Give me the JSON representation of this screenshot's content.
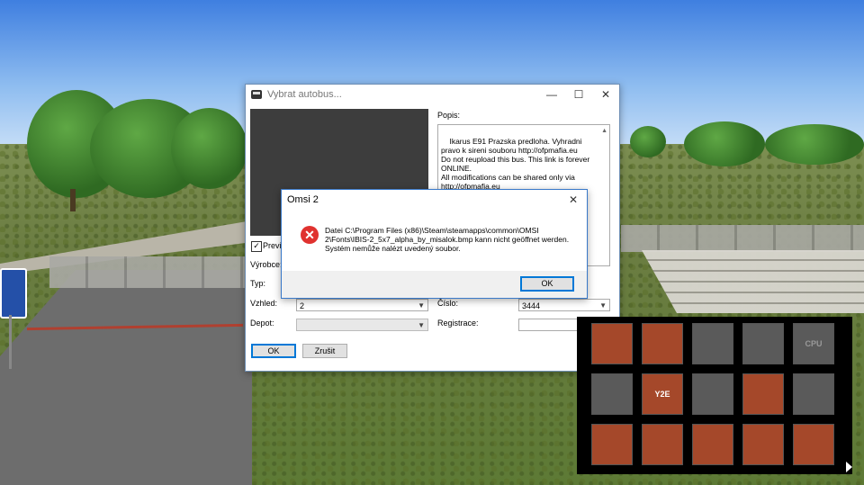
{
  "main_dialog": {
    "title": "Vybrat autobus...",
    "minimize": "—",
    "maximize": "☐",
    "close": "✕",
    "preview_label": "Preview",
    "preview_checked": "✓",
    "description_label": "Popis:",
    "description": "Ikarus E91 Prazska predloha. Vyhradni pravo k sireni souboru http://ofpmafia.eu\nDo not reupload this bus. This link is forever ONLINE.\nAll modifications can be shared only via http://ofpmafia.eu",
    "manufacturer_label": "Výrobce:",
    "type_label": "Typ:",
    "appearance_label": "Vzhled:",
    "appearance_value": "2",
    "depot_label": "Depot:",
    "depot_value": "",
    "number_label": "Číslo:",
    "number_value": "3444",
    "registration_label": "Registrace:",
    "registration_value": "",
    "ok_label": "OK",
    "cancel_label": "Zrušit"
  },
  "error_dialog": {
    "title": "Omsi 2",
    "close": "✕",
    "message_line1": "Datei C:\\Program Files (x86)\\Steam\\steamapps\\common\\OMSI 2\\Fonts\\IBIS-2_5x7_alpha_by_misalok.bmp kann nicht geöffnet werden.",
    "message_line2": "Systém nemůže nalézt uvedený soubor.",
    "ok_label": "OK"
  },
  "toolbar": {
    "tiles": [
      {
        "icon": "bus-lights-icon",
        "active": true
      },
      {
        "icon": "bus-change-icon",
        "active": true
      },
      {
        "icon": "bus-remove-icon",
        "active": false
      },
      {
        "icon": "bus-couple-icon",
        "active": false
      },
      {
        "icon": "cpu-bus-icon",
        "active": false,
        "text": "CPU"
      },
      {
        "icon": "ticket-machine-icon",
        "active": false
      },
      {
        "icon": "y2e-display-icon",
        "active": true,
        "text": "Y2E"
      },
      {
        "icon": "police-car-icon",
        "active": false
      },
      {
        "icon": "repair-tools-icon",
        "active": true
      },
      {
        "icon": "fuel-pump-icon",
        "active": false
      },
      {
        "icon": "route-question-icon",
        "active": true
      },
      {
        "icon": "clock-icon",
        "active": true
      },
      {
        "icon": "weather-icon",
        "active": true
      },
      {
        "icon": "driver-wheel-icon",
        "active": true
      },
      {
        "icon": "passenger-info-icon",
        "active": true
      }
    ],
    "colors": {
      "active": "#a5482a",
      "inactive": "#5a5a5a"
    }
  }
}
